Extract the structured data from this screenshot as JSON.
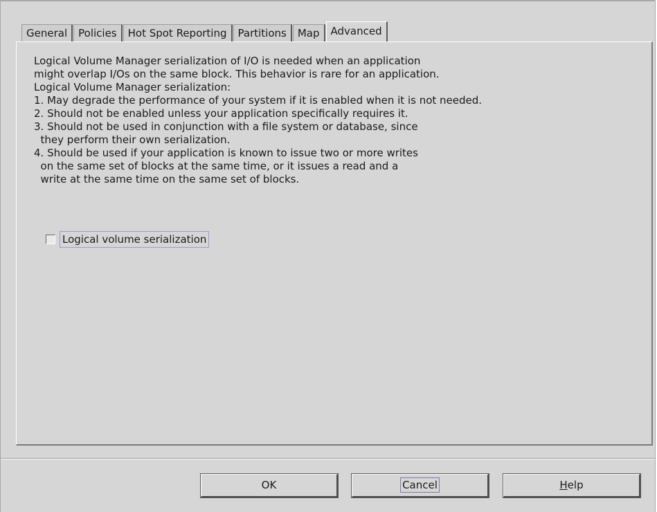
{
  "tabs": [
    {
      "label": "General",
      "active": false
    },
    {
      "label": "Policies",
      "active": false
    },
    {
      "label": "Hot Spot Reporting",
      "active": false
    },
    {
      "label": "Partitions",
      "active": false
    },
    {
      "label": "Map",
      "active": false
    },
    {
      "label": "Advanced",
      "active": true
    }
  ],
  "advanced": {
    "description": "Logical Volume Manager serialization of I/O is needed when an application\nmight overlap I/Os on the same block. This behavior is rare for an application.\nLogical Volume Manager serialization:\n1. May degrade the performance of your system if it is enabled when it is not needed.\n2. Should not be enabled unless your application specifically requires it.\n3. Should not be used in conjunction with a file system or database, since\n  they perform their own serialization.\n4. Should be used if your application is known to issue two or more writes\n  on the same set of blocks at the same time, or it issues a read and a\n  write at the same time on the same set of blocks.",
    "serialization_checkbox": {
      "label": "Logical volume serialization",
      "checked": false
    }
  },
  "buttons": {
    "ok": "OK",
    "cancel": "Cancel",
    "help_mnemonic": "H",
    "help_rest": "elp"
  }
}
